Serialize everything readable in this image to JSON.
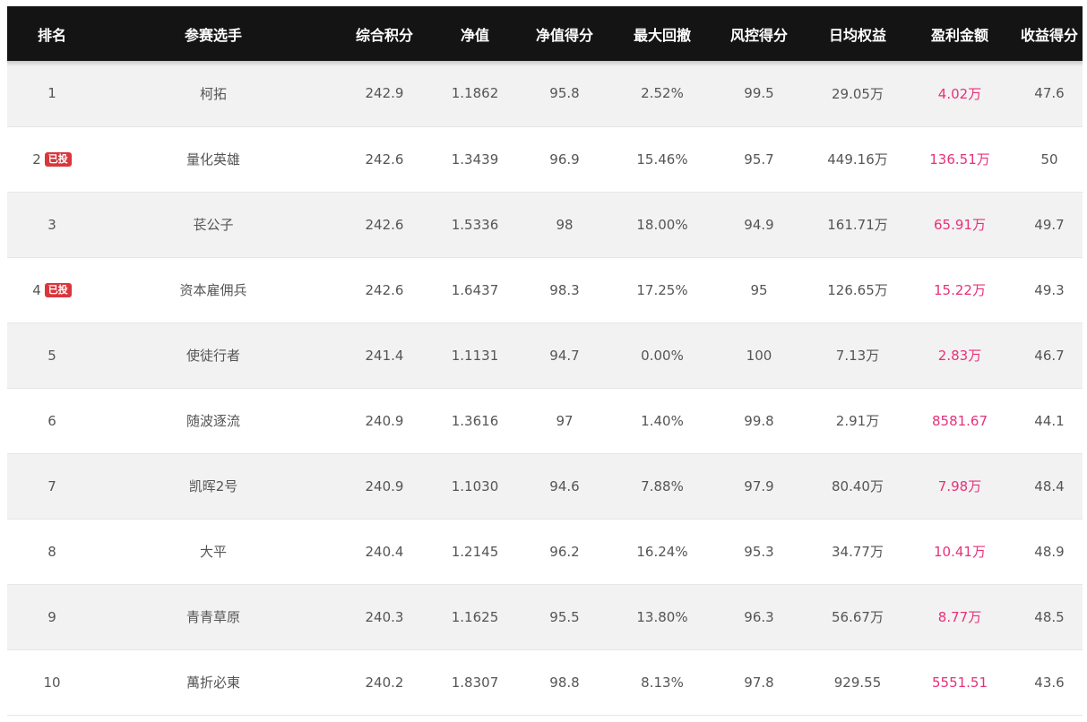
{
  "headers": [
    "排名",
    "参赛选手",
    "综合积分",
    "净值",
    "净值得分",
    "最大回撤",
    "风控得分",
    "日均权益",
    "盈利金额",
    "收益得分"
  ],
  "rows": [
    {
      "rank": "1",
      "badge": "",
      "name": "柯拓",
      "score": "242.9",
      "nav": "1.1862",
      "nav_score": "95.8",
      "drawdown": "2.52%",
      "risk_score": "99.5",
      "avg_equity": "29.05万",
      "profit": "4.02万",
      "return_score": "47.6"
    },
    {
      "rank": "2",
      "badge": "已投",
      "name": "量化英雄",
      "score": "242.6",
      "nav": "1.3439",
      "nav_score": "96.9",
      "drawdown": "15.46%",
      "risk_score": "95.7",
      "avg_equity": "449.16万",
      "profit": "136.51万",
      "return_score": "50"
    },
    {
      "rank": "3",
      "badge": "",
      "name": "苌公子",
      "score": "242.6",
      "nav": "1.5336",
      "nav_score": "98",
      "drawdown": "18.00%",
      "risk_score": "94.9",
      "avg_equity": "161.71万",
      "profit": "65.91万",
      "return_score": "49.7"
    },
    {
      "rank": "4",
      "badge": "已投",
      "name": "资本雇佣兵",
      "score": "242.6",
      "nav": "1.6437",
      "nav_score": "98.3",
      "drawdown": "17.25%",
      "risk_score": "95",
      "avg_equity": "126.65万",
      "profit": "15.22万",
      "return_score": "49.3"
    },
    {
      "rank": "5",
      "badge": "",
      "name": "使徒行者",
      "score": "241.4",
      "nav": "1.1131",
      "nav_score": "94.7",
      "drawdown": "0.00%",
      "risk_score": "100",
      "avg_equity": "7.13万",
      "profit": "2.83万",
      "return_score": "46.7"
    },
    {
      "rank": "6",
      "badge": "",
      "name": "随波逐流",
      "score": "240.9",
      "nav": "1.3616",
      "nav_score": "97",
      "drawdown": "1.40%",
      "risk_score": "99.8",
      "avg_equity": "2.91万",
      "profit": "8581.67",
      "return_score": "44.1"
    },
    {
      "rank": "7",
      "badge": "",
      "name": "凯晖2号",
      "score": "240.9",
      "nav": "1.1030",
      "nav_score": "94.6",
      "drawdown": "7.88%",
      "risk_score": "97.9",
      "avg_equity": "80.40万",
      "profit": "7.98万",
      "return_score": "48.4"
    },
    {
      "rank": "8",
      "badge": "",
      "name": "大平",
      "score": "240.4",
      "nav": "1.2145",
      "nav_score": "96.2",
      "drawdown": "16.24%",
      "risk_score": "95.3",
      "avg_equity": "34.77万",
      "profit": "10.41万",
      "return_score": "48.9"
    },
    {
      "rank": "9",
      "badge": "",
      "name": "青青草原",
      "score": "240.3",
      "nav": "1.1625",
      "nav_score": "95.5",
      "drawdown": "13.80%",
      "risk_score": "96.3",
      "avg_equity": "56.67万",
      "profit": "8.77万",
      "return_score": "48.5"
    },
    {
      "rank": "10",
      "badge": "",
      "name": "萬折必東",
      "score": "240.2",
      "nav": "1.8307",
      "nav_score": "98.8",
      "drawdown": "8.13%",
      "risk_score": "97.8",
      "avg_equity": "929.55",
      "profit": "5551.51",
      "return_score": "43.6"
    }
  ],
  "colors": {
    "header_bg": "#141414",
    "profit": "#e8307a",
    "badge": "#d9363e",
    "row_alt": "#f2f2f2"
  }
}
